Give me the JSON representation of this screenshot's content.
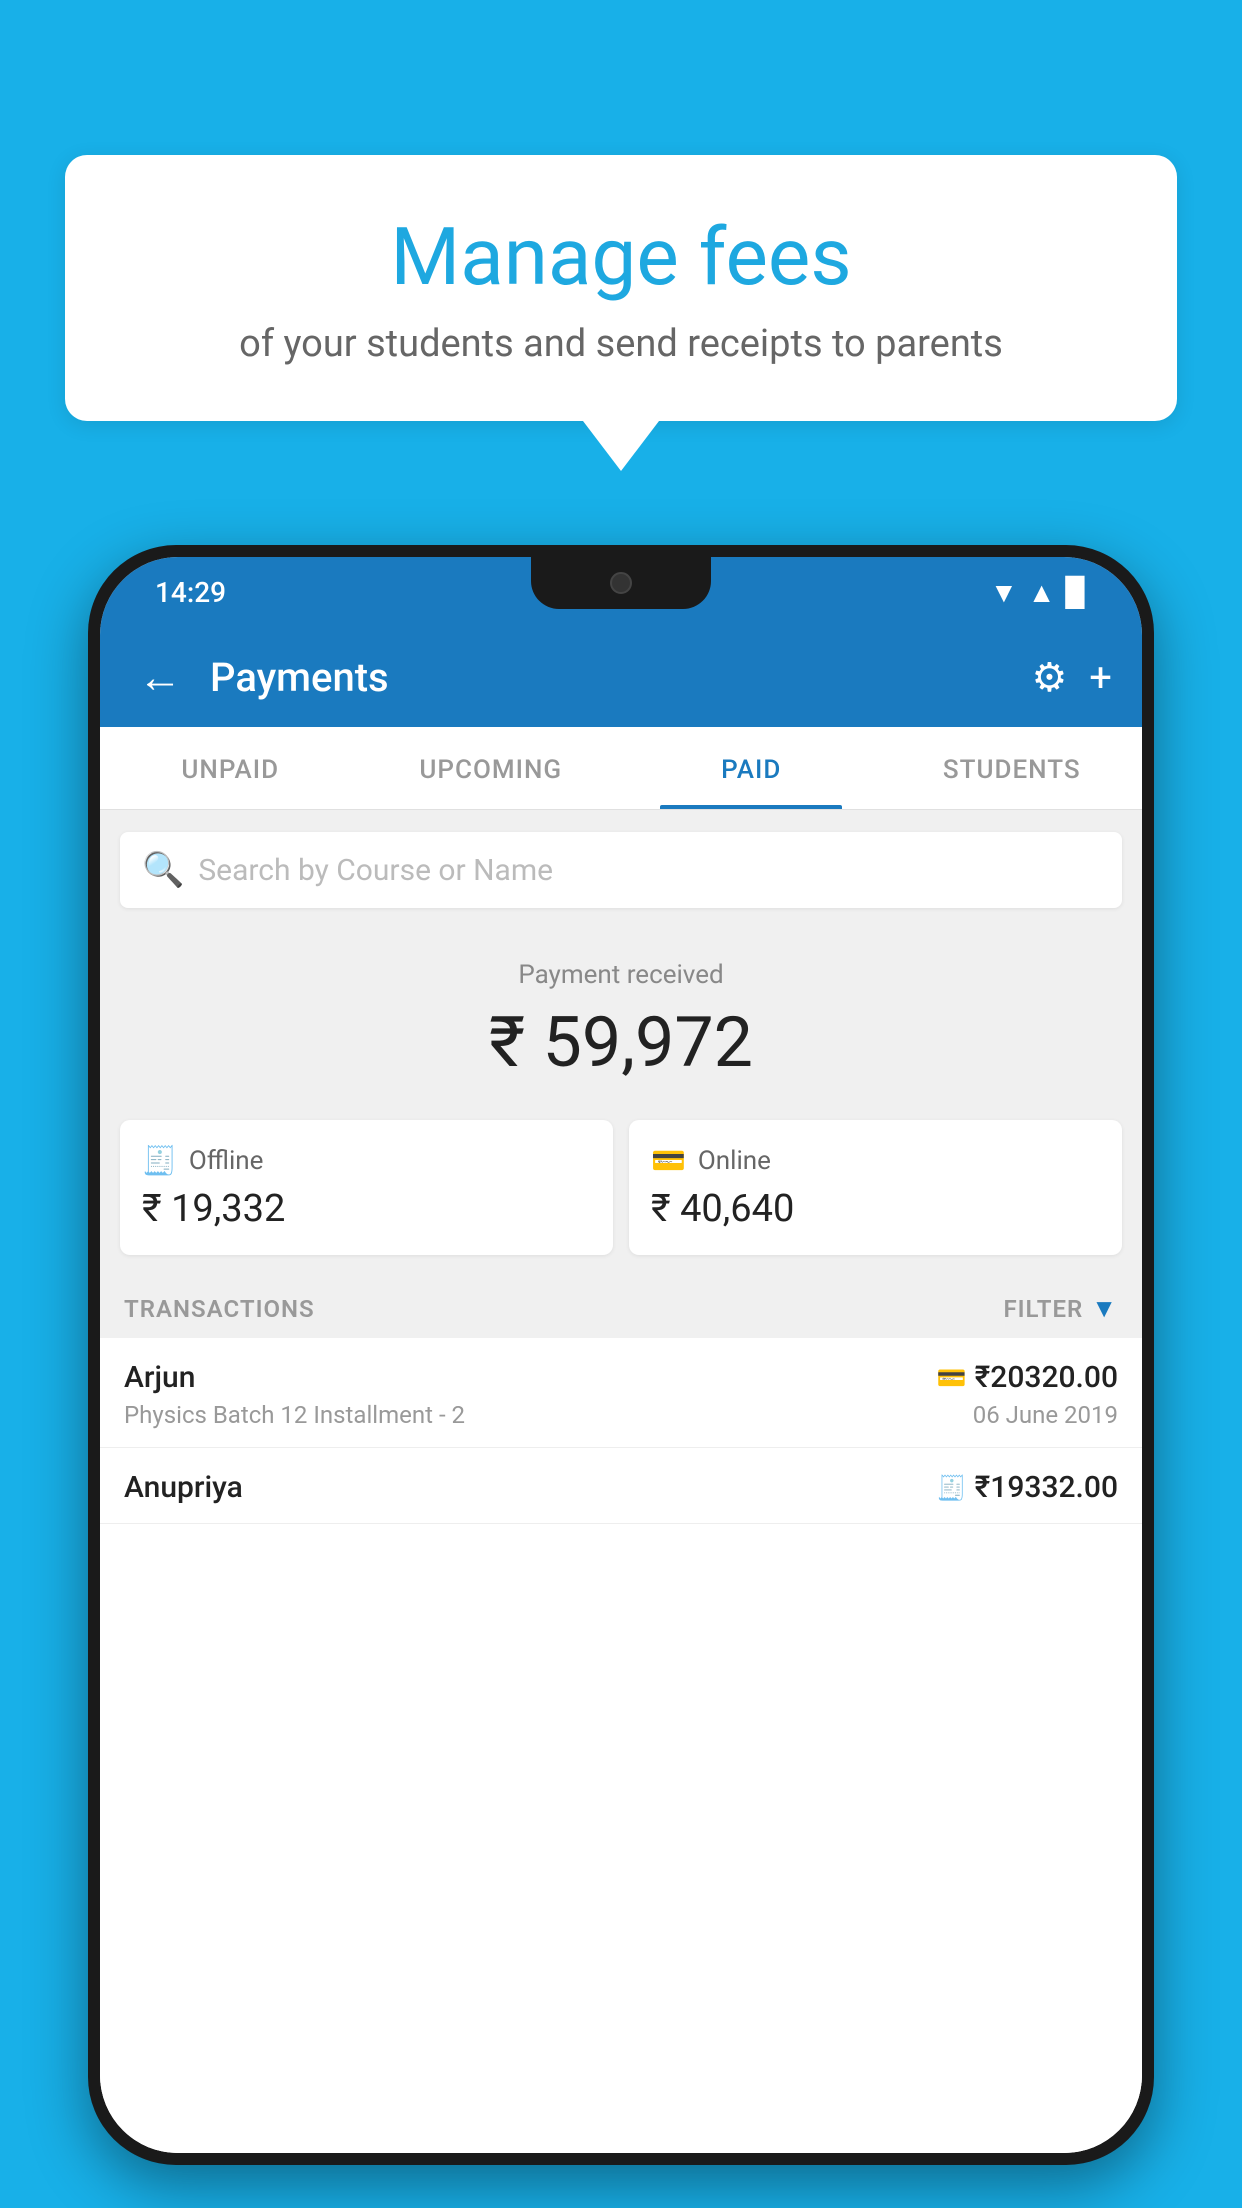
{
  "background_color": "#18b0e8",
  "speech_bubble": {
    "title": "Manage fees",
    "subtitle": "of your students and send receipts to parents"
  },
  "status_bar": {
    "time": "14:29",
    "wifi": "▲",
    "signal": "▲",
    "battery": "▉"
  },
  "app_bar": {
    "back_icon": "←",
    "title": "Payments",
    "gear_icon": "⚙",
    "plus_icon": "+"
  },
  "tabs": [
    {
      "label": "UNPAID",
      "active": false
    },
    {
      "label": "UPCOMING",
      "active": false
    },
    {
      "label": "PAID",
      "active": true
    },
    {
      "label": "STUDENTS",
      "active": false
    }
  ],
  "search": {
    "placeholder": "Search by Course or Name",
    "icon": "🔍"
  },
  "payment_summary": {
    "label": "Payment received",
    "amount": "₹ 59,972"
  },
  "payment_cards": [
    {
      "type": "Offline",
      "amount": "₹ 19,332",
      "icon": "💳"
    },
    {
      "type": "Online",
      "amount": "₹ 40,640",
      "icon": "💳"
    }
  ],
  "transactions_section": {
    "label": "TRANSACTIONS",
    "filter_label": "FILTER",
    "filter_icon": "▼"
  },
  "transactions": [
    {
      "name": "Arjun",
      "detail": "Physics Batch 12 Installment - 2",
      "amount": "₹20320.00",
      "date": "06 June 2019",
      "icon_type": "online"
    },
    {
      "name": "Anupriya",
      "detail": "",
      "amount": "₹19332.00",
      "date": "",
      "icon_type": "offline"
    }
  ]
}
